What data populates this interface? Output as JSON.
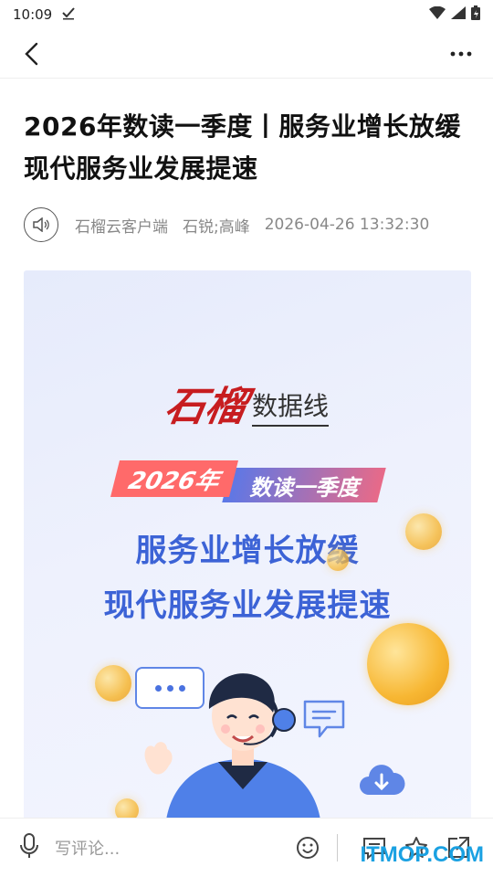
{
  "status_bar": {
    "time": "10:09"
  },
  "article": {
    "title": "2026年数读一季度丨服务业增长放缓 现代服务业发展提速",
    "source": "石榴云客户端",
    "authors": "石锐;高峰",
    "datetime": "2026-04-26 13:32:30"
  },
  "banner": {
    "brand_script": "石榴",
    "brand_suffix": "数据线",
    "ribbon_year": "2026年",
    "ribbon_text": "数读一季度",
    "headline_1": "服务业增长放缓",
    "headline_2": "现代服务业发展提速"
  },
  "bottom_bar": {
    "comment_placeholder": "写评论..."
  },
  "watermark": "ITMOP.COM"
}
